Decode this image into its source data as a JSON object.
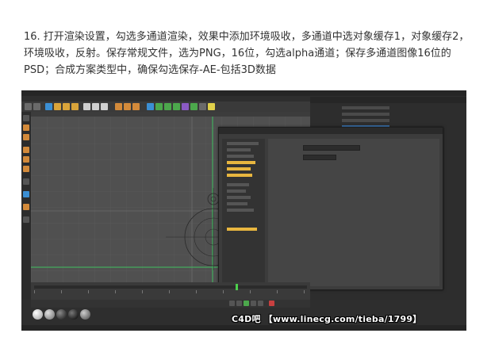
{
  "instruction": {
    "text": "16. 打开渲染设置，勾选多通道渲染，效果中添加环境吸收，多通道中选对象缓存1，对象缓存2，环境吸收，反射。保存常规文件，选为PNG，16位，勾选alpha通道；保存多通道图像16位的PSD；合成方案类型中，确保勾选保存-AE-包括3D数据"
  },
  "watermark": {
    "text": "C4D吧 【www.linecg.com/tieba/1799】"
  },
  "colors": {
    "viewport_bg": "#505050",
    "guide_green": "#3fbf5f",
    "highlight": "#e8b63f",
    "timeline_cursor": "#4ccf4c"
  }
}
